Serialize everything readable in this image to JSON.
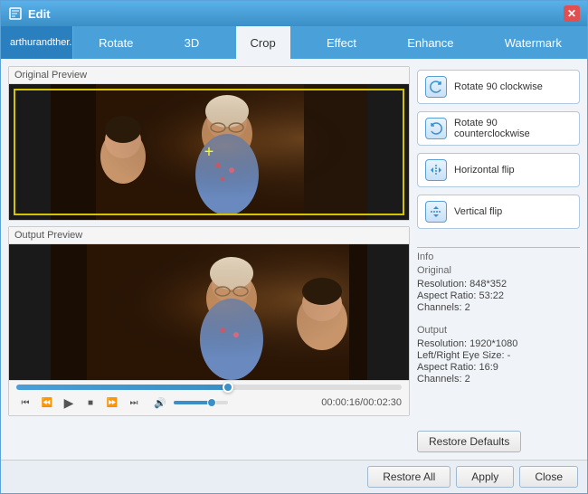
{
  "window": {
    "title": "Edit",
    "close_label": "✕"
  },
  "file_tab": {
    "label": "arthurandther..."
  },
  "tabs": [
    {
      "id": "rotate",
      "label": "Rotate"
    },
    {
      "id": "3d",
      "label": "3D"
    },
    {
      "id": "crop",
      "label": "Crop"
    },
    {
      "id": "effect",
      "label": "Effect"
    },
    {
      "id": "enhance",
      "label": "Enhance"
    },
    {
      "id": "watermark",
      "label": "Watermark"
    }
  ],
  "active_tab": "crop",
  "original_preview": {
    "label": "Original Preview"
  },
  "output_preview": {
    "label": "Output Preview"
  },
  "actions": [
    {
      "id": "rotate_cw",
      "label": "Rotate 90 clockwise",
      "icon": "↻"
    },
    {
      "id": "rotate_ccw",
      "label": "Rotate 90 counterclockwise",
      "icon": "↺"
    },
    {
      "id": "h_flip",
      "label": "Horizontal flip",
      "icon": "⇔"
    },
    {
      "id": "v_flip",
      "label": "Vertical flip",
      "icon": "⇕"
    }
  ],
  "info": {
    "section_label": "Info",
    "original_label": "Original",
    "original_resolution": "Resolution: 848*352",
    "original_aspect": "Aspect Ratio: 53:22",
    "original_channels": "Channels: 2",
    "output_label": "Output",
    "output_resolution": "Resolution: 1920*1080",
    "output_lr_size": "Left/Right Eye Size: -",
    "output_aspect": "Aspect Ratio: 16:9",
    "output_channels": "Channels: 2"
  },
  "playback": {
    "time": "00:00:16/00:02:30"
  },
  "bottom_bar": {
    "restore_defaults": "Restore Defaults",
    "restore_all": "Restore All",
    "apply": "Apply",
    "close": "Close"
  }
}
